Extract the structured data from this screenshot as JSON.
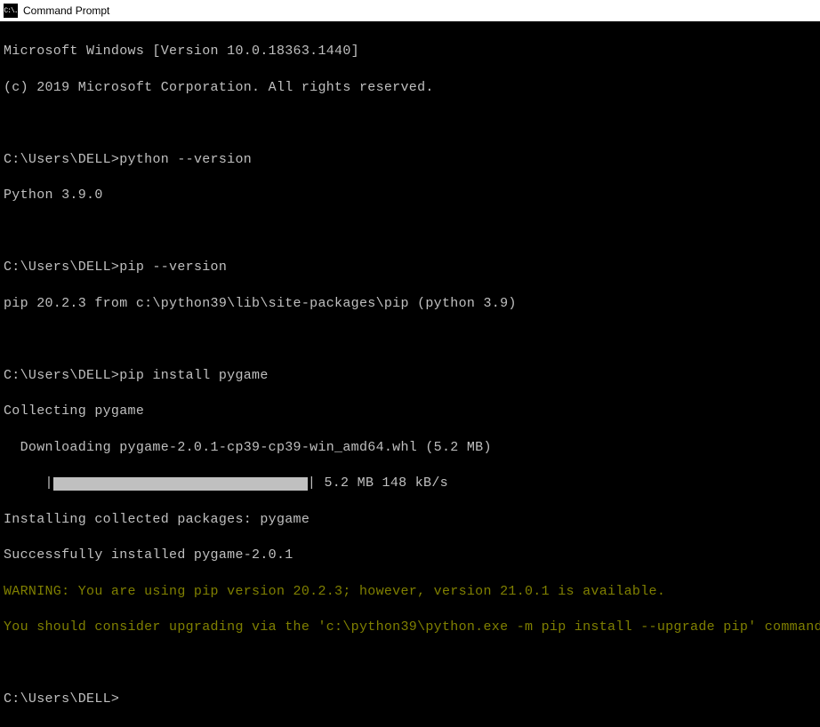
{
  "titlebar": {
    "icon_label": "C:\\.",
    "title": "Command Prompt"
  },
  "terminal": {
    "header1": "Microsoft Windows [Version 10.0.18363.1440]",
    "header2": "(c) 2019 Microsoft Corporation. All rights reserved.",
    "prompt_path": "C:\\Users\\DELL>",
    "cmd1": "python --version",
    "out1": "Python 3.9.0",
    "cmd2": "pip --version",
    "out2": "pip 20.2.3 from c:\\python39\\lib\\site-packages\\pip (python 3.9)",
    "cmd3": "pip install pygame",
    "collect": "Collecting pygame",
    "download": "  Downloading pygame-2.0.1-cp39-cp39-win_amd64.whl (5.2 MB)",
    "progress_pad": "     ",
    "progress_tail": " 5.2 MB 148 kB/s",
    "install": "Installing collected packages: pygame",
    "success": "Successfully installed pygame-2.0.1",
    "warn1": "WARNING: You are using pip version 20.2.3; however, version 21.0.1 is available.",
    "warn2": "You should consider upgrading via the 'c:\\python39\\python.exe -m pip install --upgrade pip' command."
  }
}
